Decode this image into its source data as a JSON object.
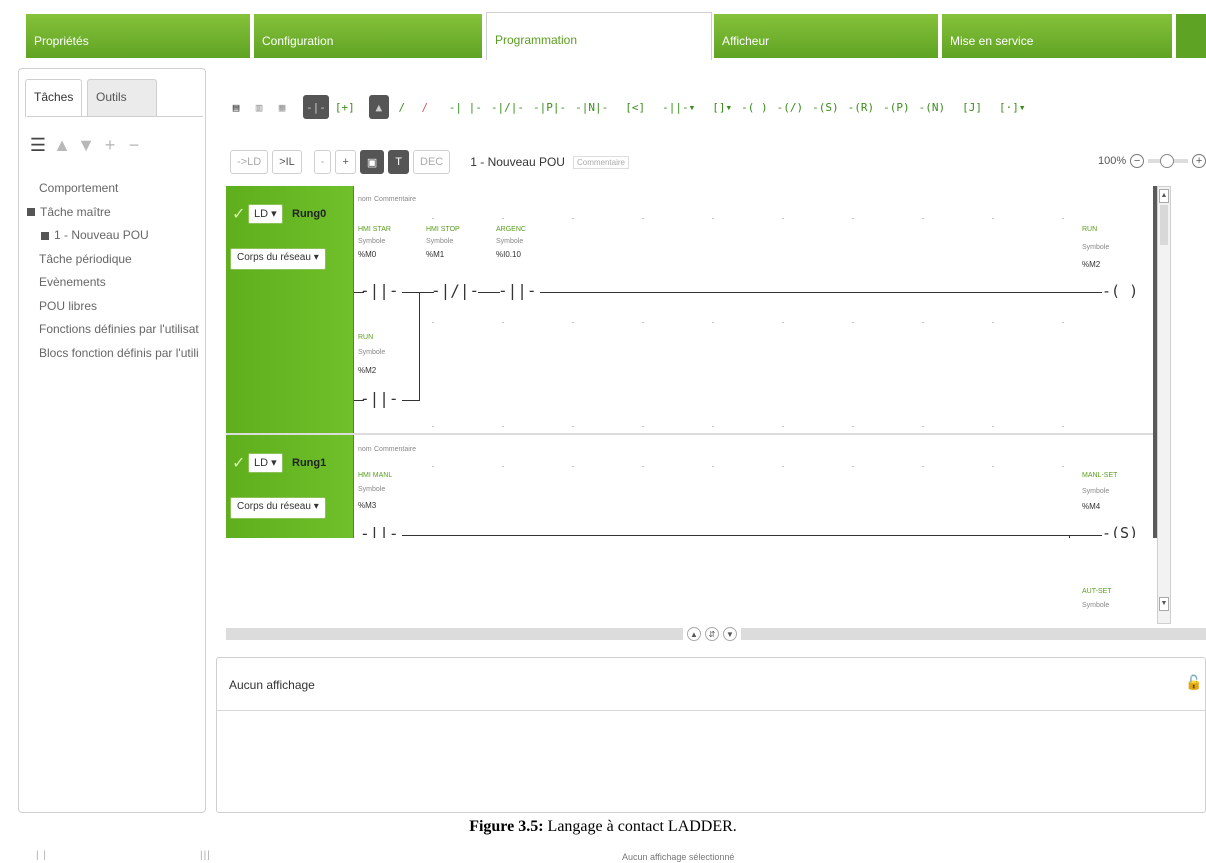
{
  "tabs": [
    {
      "label": "Propriétés"
    },
    {
      "label": "Configuration"
    },
    {
      "label": "Programmation"
    },
    {
      "label": "Afficheur"
    },
    {
      "label": "Mise en service"
    }
  ],
  "left_panel": {
    "tabs": [
      {
        "label": "Tâches"
      },
      {
        "label": "Outils"
      }
    ],
    "tree": [
      {
        "label": "Comportement"
      },
      {
        "label": "Tâche maître"
      },
      {
        "label": "1 - Nouveau POU"
      },
      {
        "label": "Tâche périodique"
      },
      {
        "label": "Evènements"
      },
      {
        "label": "POU libres"
      },
      {
        "label": "Fonctions définies par l'utilisat"
      },
      {
        "label": "Blocs fonction définis par l'utili"
      }
    ]
  },
  "toolbar2": {
    "btn_ld": "->LD",
    "btn_il": ">IL",
    "btn_minus": "-",
    "btn_plus": "+",
    "btn_dec": "DEC",
    "pou_name": "1 - Nouveau POU",
    "pou_comment": "Commentaire",
    "zoom": "100%"
  },
  "rungs": [
    {
      "lang": "LD",
      "name": "Rung0",
      "corps": "Corps du réseau",
      "comment_prefix": "nom",
      "comment": "Commentaire",
      "contacts": [
        {
          "symbol": "HMI STAR",
          "sublabel": "Symbole",
          "address": "%M0",
          "kind": "NO"
        },
        {
          "symbol": "HMI STOP",
          "sublabel": "Symbole",
          "address": "%M1",
          "kind": "NC"
        },
        {
          "symbol": "ARGENC",
          "sublabel": "Symbole",
          "address": "%I0.10",
          "kind": "NO"
        },
        {
          "symbol": "RUN",
          "sublabel": "Symbole",
          "address": "%M2",
          "kind": "NO"
        }
      ],
      "coil": {
        "symbol": "RUN",
        "sublabel": "Symbole",
        "address": "%M2",
        "kind": "( )"
      }
    },
    {
      "lang": "LD",
      "name": "Rung1",
      "corps": "Corps du réseau",
      "comment_prefix": "nom",
      "comment": "Commentaire",
      "contacts": [
        {
          "symbol": "HMI MANL",
          "sublabel": "Symbole",
          "address": "%M3",
          "kind": "NO"
        }
      ],
      "coil": {
        "symbol": "MANL-SET",
        "sublabel": "Symbole",
        "address": "%M4",
        "kind": "(S)"
      },
      "next_label": {
        "symbol": "AUT-SET",
        "sublabel": "Symbole"
      }
    }
  ],
  "bottom_panel": {
    "title": "Aucun affichage"
  },
  "caption": {
    "bold": "Figure 3.5:",
    "text": " Langage à contact LADDER."
  },
  "footer_strip": {
    "text": "Aucun affichage sélectionné"
  }
}
